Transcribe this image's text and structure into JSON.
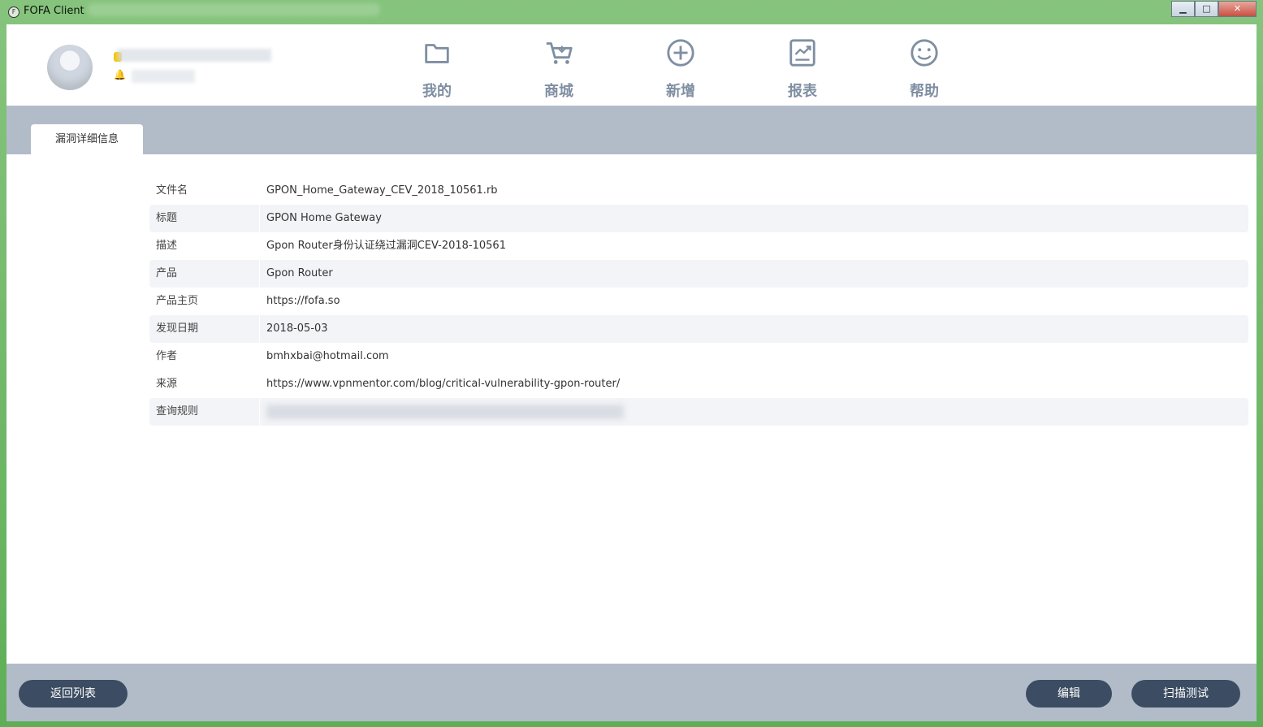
{
  "window": {
    "title": "FOFA Client",
    "icon": "fofa-app-icon",
    "controls": [
      "minimize",
      "maximize",
      "close"
    ]
  },
  "user": {
    "avatar": "default-avatar-icon",
    "badge_color": "#f3c400"
  },
  "nav": {
    "items": [
      {
        "label": "我的",
        "icon": "folder-icon"
      },
      {
        "label": "商城",
        "icon": "shopping-cart-icon"
      },
      {
        "label": "新增",
        "icon": "plus-circle-icon"
      },
      {
        "label": "报表",
        "icon": "chart-report-icon"
      },
      {
        "label": "帮助",
        "icon": "smile-help-icon"
      }
    ],
    "icon_color": "#7f8fa2"
  },
  "tab": {
    "label": "漏洞详细信息"
  },
  "details": {
    "rows": [
      {
        "label": "文件名",
        "value": "GPON_Home_Gateway_CEV_2018_10561.rb"
      },
      {
        "label": "标题",
        "value": "GPON Home Gateway"
      },
      {
        "label": "描述",
        "value": "Gpon Router身份认证绕过漏洞CEV-2018-10561"
      },
      {
        "label": "产品",
        "value": "Gpon Router"
      },
      {
        "label": "产品主页",
        "value": "https://fofa.so"
      },
      {
        "label": "发现日期",
        "value": "2018-05-03"
      },
      {
        "label": "作者",
        "value": "bmhxbai@hotmail.com"
      },
      {
        "label": "来源",
        "value": "https://www.vpnmentor.com/blog/critical-vulnerability-gpon-router/"
      },
      {
        "label": "查询规则",
        "value": ""
      }
    ]
  },
  "footer": {
    "back_label": "返回列表",
    "edit_label": "编辑",
    "scan_label": "扫描测试",
    "button_color": "#3c4c62"
  }
}
